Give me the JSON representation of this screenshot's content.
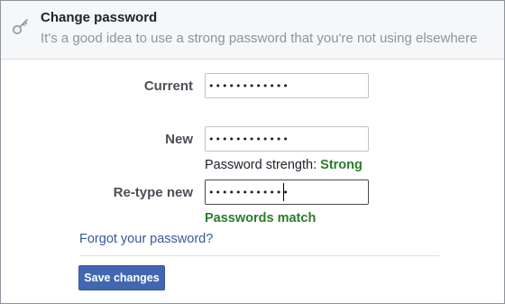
{
  "header": {
    "icon": "key-icon",
    "title": "Change password",
    "subtitle": "It's a good idea to use a strong password that you're not using elsewhere"
  },
  "form": {
    "current": {
      "label": "Current",
      "value": "••••••••••••"
    },
    "new": {
      "label": "New",
      "value": "••••••••••••"
    },
    "strength": {
      "prefix": "Password strength:",
      "value": "Strong"
    },
    "retype": {
      "label": "Re-type new",
      "value": "••••••••••••"
    },
    "match_text": "Passwords match"
  },
  "links": {
    "forgot": "Forgot your password?"
  },
  "actions": {
    "save_label": "Save changes"
  },
  "colors": {
    "accent": "#4267b2",
    "link": "#385898",
    "success": "#2a7d2a"
  }
}
